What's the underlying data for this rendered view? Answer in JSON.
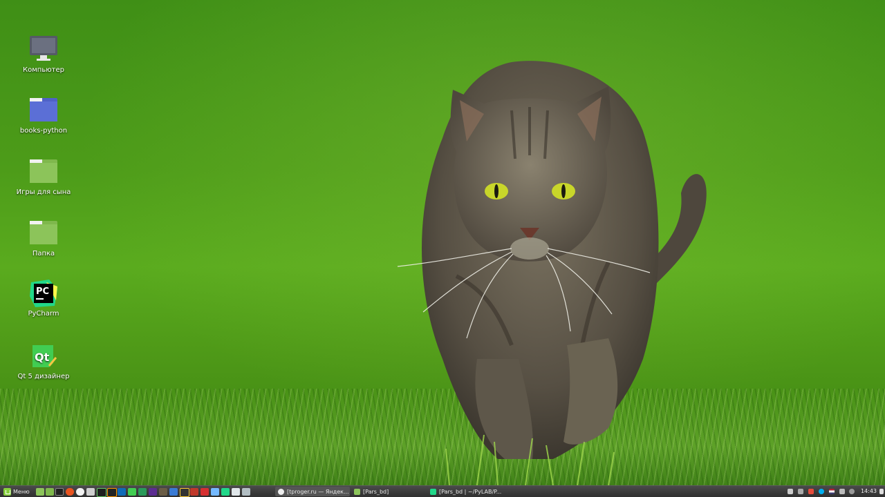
{
  "desktop": {
    "icons": [
      {
        "label": "Компьютер",
        "icon": "computer-icon"
      },
      {
        "label": "books-python",
        "icon": "folder-icon"
      },
      {
        "label": "Игры для сына",
        "icon": "folder-icon"
      },
      {
        "label": "Папка",
        "icon": "folder-icon"
      },
      {
        "label": "PyCharm",
        "icon": "pycharm-icon"
      },
      {
        "label": "Qt 5 дизайнер",
        "icon": "qt-designer-icon"
      }
    ]
  },
  "taskbar": {
    "menu_label": "Меню",
    "launchers": [
      "show-desktop-icon",
      "files-icon",
      "terminal-icon",
      "ubuntu-icon",
      "yandex-browser-icon",
      "settings-icon",
      "terminal2-icon",
      "sublime-icon",
      "vscode-icon",
      "qt-icon",
      "app-icon",
      "vs-icon",
      "gimp-icon",
      "app2-icon",
      "archive-icon",
      "app3-icon",
      "app4-icon",
      "app5-icon",
      "pycharm-icon",
      "app6-icon",
      "app7-icon"
    ],
    "windows": [
      {
        "label": "[tproger.ru — Яндек...",
        "icon": "yandex-browser-icon",
        "active": true
      },
      {
        "label": "[Pars_bd]",
        "icon": "folder-icon",
        "active": false
      },
      {
        "label": "[Pars_bd | ~/PyLAB/P...",
        "icon": "pycharm-icon",
        "active": false
      }
    ],
    "tray": [
      "clipboard-icon",
      "camera-icon",
      "shield-icon",
      "skype-icon",
      "flag-icon",
      "network-icon",
      "user-icon",
      "bluetooth-icon"
    ],
    "clock": "14:43",
    "colors": {
      "panel": "#2f2f2f",
      "accent": "#87cf3e"
    }
  }
}
